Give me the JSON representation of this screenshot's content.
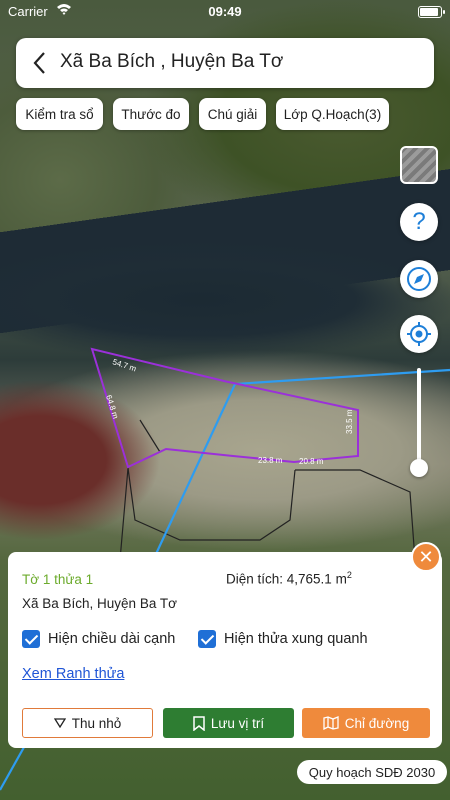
{
  "status_bar": {
    "carrier": "Carrier",
    "time": "09:49"
  },
  "header": {
    "title": "Xã Ba Bích , Huyện Ba Tơ"
  },
  "chips": [
    {
      "label": "Kiểm tra sổ"
    },
    {
      "label": "Thước đo"
    },
    {
      "label": "Chú giải"
    },
    {
      "label": "Lớp Q.Hoạch(3)"
    }
  ],
  "tools": {
    "help_glyph": "?",
    "icons": [
      "layer-thumbnail-icon",
      "help-icon",
      "compass-icon",
      "locate-icon"
    ]
  },
  "map": {
    "edge_labels": [
      "54.7 m",
      "64.8 m",
      "23.8 m",
      "20.8 m",
      "33.5 m"
    ],
    "colors": {
      "parcel_outline": "#9b30d9",
      "road": "#2e9cf0",
      "neighbor_outline": "#222222"
    }
  },
  "card": {
    "parcel": "Tờ 1 thửa 1",
    "area_label": "Diện tích: 4,765.1 m",
    "area_unit_sup": "2",
    "location": "Xã Ba Bích, Huyện Ba Tơ",
    "checkbox_edge_length": {
      "label": "Hiện chiều dài cạnh",
      "checked": true
    },
    "checkbox_neighbors": {
      "label": "Hiện thửa xung quanh",
      "checked": true
    },
    "view_boundary_link": "Xem Ranh thửa",
    "buttons": {
      "collapse": "Thu nhỏ",
      "save": "Lưu vị trí",
      "directions": "Chỉ đường"
    },
    "close_glyph": "✕"
  },
  "plan_badge": "Quy hoạch SDĐ 2030",
  "colors": {
    "accent_orange": "#ef8a3c",
    "save_green": "#2e7d32",
    "link_blue": "#1f55d6",
    "parcel_green": "#6cab2c"
  }
}
